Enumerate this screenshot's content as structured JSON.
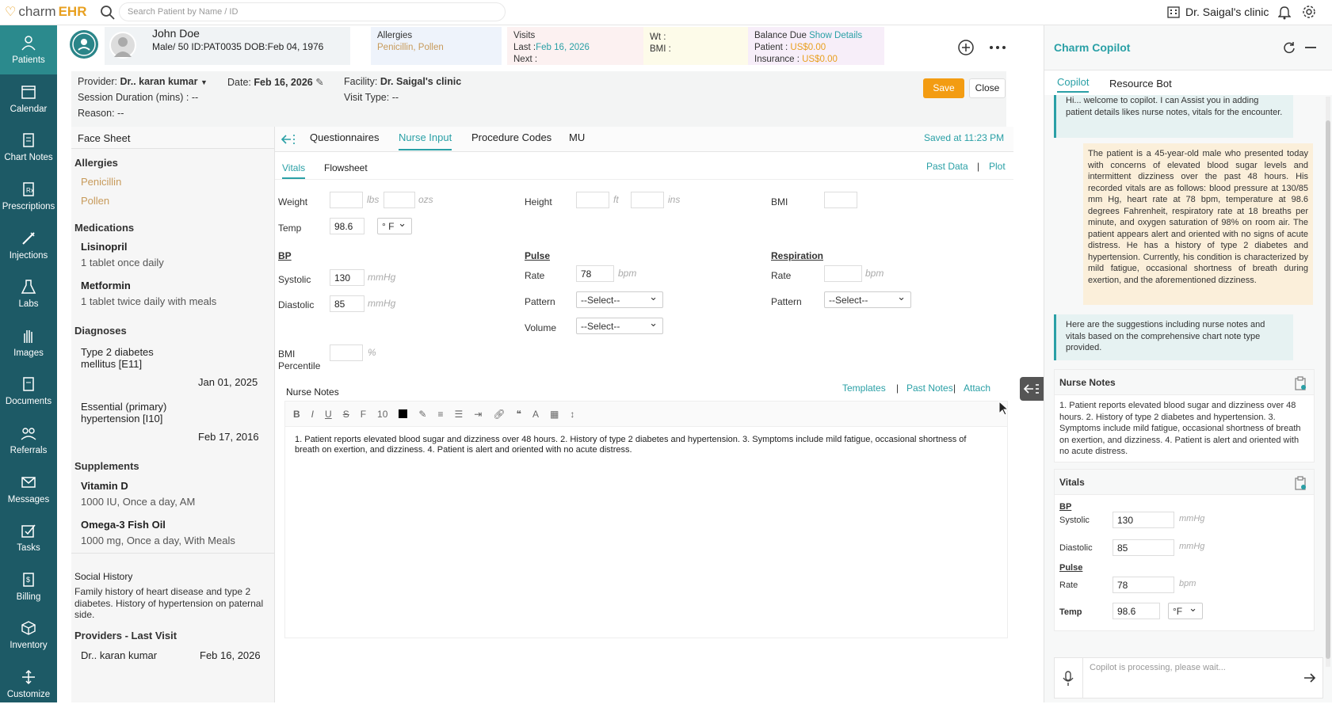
{
  "topbar": {
    "logo_prefix": "charm",
    "logo_suffix": "EHR",
    "search_placeholder": "Search Patient by Name / ID",
    "clinic": "Dr. Saigal's clinic"
  },
  "sidebar": {
    "items": [
      {
        "label": "Patients",
        "icon": "patients-icon"
      },
      {
        "label": "Calendar",
        "icon": "calendar-icon"
      },
      {
        "label": "Chart Notes",
        "icon": "chart-notes-icon"
      },
      {
        "label": "Prescriptions",
        "icon": "prescriptions-icon"
      },
      {
        "label": "Injections",
        "icon": "injections-icon"
      },
      {
        "label": "Labs",
        "icon": "labs-icon"
      },
      {
        "label": "Images",
        "icon": "images-icon"
      },
      {
        "label": "Documents",
        "icon": "documents-icon"
      },
      {
        "label": "Referrals",
        "icon": "referrals-icon"
      },
      {
        "label": "Messages",
        "icon": "messages-icon"
      },
      {
        "label": "Tasks",
        "icon": "tasks-icon"
      },
      {
        "label": "Billing",
        "icon": "billing-icon"
      },
      {
        "label": "Inventory",
        "icon": "inventory-icon"
      },
      {
        "label": "Customize",
        "icon": "customize-icon"
      }
    ]
  },
  "patient": {
    "name": "John Doe",
    "details": "Male/ 50  ID:PAT0035  DOB:Feb 04, 1976",
    "allergies_label": "Allergies",
    "allergies_value": "Penicillin, Pollen",
    "visits_label": "Visits",
    "visits_last_label": "Last :",
    "visits_last_value": "Feb 16, 2026",
    "visits_next_label": "Next :",
    "wt_label": "Wt   :",
    "bmi_label": "BMI  :",
    "balance_label": "Balance Due",
    "show_details": "Show Details",
    "patient_bal_label": "Patient :",
    "patient_bal_value": "US$0.00",
    "insurance_bal_label": "Insurance :",
    "insurance_bal_value": "US$0.00"
  },
  "encounter": {
    "provider_label": "Provider:",
    "provider_value": "Dr.. karan kumar",
    "date_label": "Date:",
    "date_value": "Feb 16, 2026",
    "facility_label": "Facility:",
    "facility_value": "Dr. Saigal's clinic",
    "session_label": "Session Duration (mins) :",
    "session_value": "--",
    "visit_type_label": "Visit Type:",
    "visit_type_value": "--",
    "reason_label": "Reason:",
    "reason_value": "--",
    "save": "Save",
    "close": "Close"
  },
  "facesheet": {
    "title": "Face Sheet",
    "allergies_title": "Allergies",
    "allergies": [
      "Penicillin",
      "Pollen"
    ],
    "medications_title": "Medications",
    "medications": [
      {
        "name": "Lisinopril",
        "dose": "1 tablet once daily"
      },
      {
        "name": "Metformin",
        "dose": "1 tablet twice daily with meals"
      }
    ],
    "diagnoses_title": "Diagnoses",
    "diagnoses": [
      {
        "name_line1": "Type 2 diabetes",
        "name_line2": "mellitus [E11]",
        "date": "Jan 01, 2025"
      },
      {
        "name_line1": "Essential (primary)",
        "name_line2": "hypertension [I10]",
        "date": "Feb 17, 2016"
      }
    ],
    "supplements_title": "Supplements",
    "supplements": [
      {
        "name": "Vitamin D",
        "dose": "1000 IU, Once a day, AM"
      },
      {
        "name": "Omega-3 Fish Oil",
        "dose": "1000 mg, Once a day, With Meals"
      }
    ],
    "social_title": "Social History",
    "social_text": "Family history of heart disease and type 2 diabetes. History of hypertension on paternal side.",
    "providers_title": "Providers  -  Last Visit",
    "provider_name": "Dr.. karan kumar",
    "provider_date": "Feb 16, 2026"
  },
  "tabs": {
    "items": [
      "Questionnaires",
      "Nurse Input",
      "Procedure Codes",
      "MU"
    ],
    "active": "Nurse Input",
    "saved": "Saved at 11:23 PM",
    "sub_vitals": "Vitals",
    "sub_flowsheet": "Flowsheet",
    "past_data": "Past Data",
    "plot": "Plot",
    "sep": "|"
  },
  "vitals": {
    "weight_label": "Weight",
    "lbs": "lbs",
    "ozs": "ozs",
    "height_label": "Height",
    "ft": "ft",
    "ins": "ins",
    "bmi_label": "BMI",
    "temp_label": "Temp",
    "temp_value": "98.6",
    "temp_unit": "° F",
    "bp_title": "BP",
    "systolic_label": "Systolic",
    "systolic_value": "130",
    "diastolic_label": "Diastolic",
    "diastolic_value": "85",
    "mmhg": "mmHg",
    "pulse_title": "Pulse",
    "rate_label": "Rate",
    "pulse_rate_value": "78",
    "bpm": "bpm",
    "pattern_label": "Pattern",
    "volume_label": "Volume",
    "select_placeholder": "--Select--",
    "resp_title": "Respiration",
    "bmi_percentile_line1": "BMI",
    "bmi_percentile_line2": "Percentile",
    "percent": "%"
  },
  "nurse_notes": {
    "title": "Nurse Notes",
    "templates": "Templates",
    "past_notes": "Past Notes",
    "attach": "Attach",
    "font_size": "10",
    "text_line1": "1. Patient reports elevated blood sugar and dizziness over 48 hours. 2. History of type 2 diabetes and hypertension. 3. Symptoms include mild fatigue, occasional shortness of",
    "text_line2": "breath on exertion, and dizziness. 4. Patient is alert and oriented with no acute distress."
  },
  "copilot": {
    "title": "Charm Copilot",
    "tab_copilot": "Copilot",
    "tab_resource": "Resource Bot",
    "bot_msg1": "Hi... welcome to copilot. I can Assist you in adding patient details likes nurse notes, vitals for the encounter.",
    "user_msg": "The patient is a 45-year-old male who presented today with concerns of elevated blood sugar levels and intermittent dizziness over the past 48 hours. His recorded vitals are as follows: blood pressure at 130/85 mm Hg, heart rate at 78 bpm, temperature at 98.6 degrees Fahrenheit, respiratory rate at 18 breaths per minute, and oxygen saturation of 98% on room air. The patient appears alert and oriented with no signs of acute distress. He has a history of type 2 diabetes and hypertension. Currently, his condition is characterized by mild fatigue, occasional shortness of breath during exertion, and the aforementioned dizziness.",
    "bot_msg2": "Here are the suggestions including nurse notes and vitals based on the comprehensive chart note type provided.",
    "notes_title": "Nurse Notes",
    "notes_text": "1. Patient reports elevated blood sugar and dizziness over 48 hours. 2. History of type 2 diabetes and hypertension. 3. Symptoms include mild fatigue, occasional shortness of breath on exertion, and dizziness. 4. Patient is alert and oriented with no acute distress.",
    "vitals_title": "Vitals",
    "bp": "BP",
    "systolic_label": "Systolic",
    "systolic_value": "130",
    "diastolic_label": "Diastolic",
    "diastolic_value": "85",
    "mmhg": "mmHg",
    "pulse": "Pulse",
    "rate_label": "Rate",
    "rate_value": "78",
    "bpm": "bpm",
    "temp_label": "Temp",
    "temp_value": "98.6",
    "temp_unit": "°F",
    "input_placeholder": "Copilot is processing, please wait..."
  }
}
